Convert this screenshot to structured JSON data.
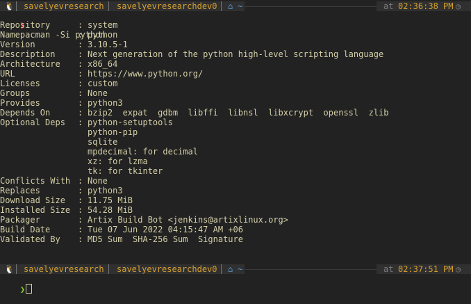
{
  "prompt_bar_1": {
    "os_icon": "linux-tux-icon",
    "user": "savelyevresearch",
    "host": "savelyevresearchdev0",
    "dir_icon": "home-icon",
    "dir": "~",
    "time_prefix": "at",
    "time": "02:36:38 PM",
    "clock_icon": "clock-icon"
  },
  "command": {
    "prompt_symbol": "❯",
    "text": "pacman -Si python"
  },
  "package_info": [
    {
      "key": "Repository",
      "value": "system"
    },
    {
      "key": "Name",
      "value": "python"
    },
    {
      "key": "Version",
      "value": "3.10.5-1"
    },
    {
      "key": "Description",
      "value": "Next generation of the python high-level scripting language"
    },
    {
      "key": "Architecture",
      "value": "x86_64"
    },
    {
      "key": "URL",
      "value": "https://www.python.org/"
    },
    {
      "key": "Licenses",
      "value": "custom"
    },
    {
      "key": "Groups",
      "value": "None"
    },
    {
      "key": "Provides",
      "value": "python3"
    },
    {
      "key": "Depends On",
      "value": "bzip2  expat  gdbm  libffi  libnsl  libxcrypt  openssl  zlib"
    },
    {
      "key": "Optional Deps",
      "value": "python-setuptools"
    },
    {
      "key": "",
      "value": "python-pip"
    },
    {
      "key": "",
      "value": "sqlite"
    },
    {
      "key": "",
      "value": "mpdecimal: for decimal"
    },
    {
      "key": "",
      "value": "xz: for lzma"
    },
    {
      "key": "",
      "value": "tk: for tkinter"
    },
    {
      "key": "Conflicts With",
      "value": "None"
    },
    {
      "key": "Replaces",
      "value": "python3"
    },
    {
      "key": "Download Size",
      "value": "11.75 MiB"
    },
    {
      "key": "Installed Size",
      "value": "54.28 MiB"
    },
    {
      "key": "Packager",
      "value": "Artix Build Bot <jenkins@artixlinux.org>"
    },
    {
      "key": "Build Date",
      "value": "Tue 07 Jun 2022 04:15:47 AM +06"
    },
    {
      "key": "Validated By",
      "value": "MD5 Sum  SHA-256 Sum  Signature"
    }
  ],
  "separator": ":",
  "prompt_bar_2": {
    "os_icon": "linux-tux-icon",
    "user": "savelyevresearch",
    "host": "savelyevresearchdev0",
    "dir_icon": "home-icon",
    "dir": "~",
    "time_prefix": "at",
    "time": "02:37:51 PM",
    "clock_icon": "clock-icon"
  },
  "input_line": {
    "prompt_symbol": "❯"
  },
  "colors": {
    "background": "#222222",
    "foreground": "#d4cfa8",
    "segment_text": "#d7a12f",
    "dir": "#5f9fdf",
    "prompt_error": "#ef3b3b",
    "prompt_ok": "#8ad92f"
  }
}
